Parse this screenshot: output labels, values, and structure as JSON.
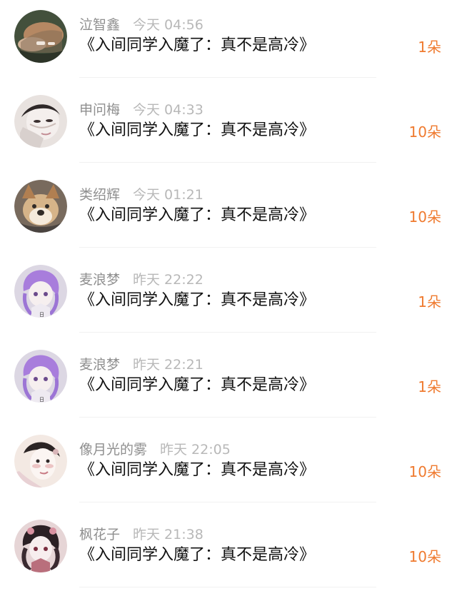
{
  "messages": [
    {
      "user": "泣智鑫",
      "time": "今天 04:56",
      "title": "《入间同学入魔了：真不是高冷》",
      "gift": "1朵",
      "avatar_icon": "avatar-photo-icon",
      "avatar_colors": [
        "#47503d",
        "#b78863",
        "#2c3527"
      ]
    },
    {
      "user": "申问梅",
      "time": "今天 04:33",
      "title": "《入间同学入魔了：真不是高冷》",
      "gift": "10朵",
      "avatar_icon": "avatar-photo-icon",
      "avatar_colors": [
        "#e7e1df",
        "#ddd3d0",
        "#312a2a"
      ]
    },
    {
      "user": "类绍辉",
      "time": "今天 01:21",
      "title": "《入间同学入魔了：真不是高冷》",
      "gift": "10朵",
      "avatar_icon": "avatar-dog-icon",
      "avatar_colors": [
        "#7d6c5c",
        "#d9b58c",
        "#37302c"
      ]
    },
    {
      "user": "麦浪梦",
      "time": "昨天 22:22",
      "title": "《入间同学入魔了：真不是高冷》",
      "gift": "1朵",
      "avatar_icon": "avatar-anime-icon",
      "avatar_colors": [
        "#d8d2e0",
        "#a57bd8",
        "#5d4a6d"
      ]
    },
    {
      "user": "麦浪梦",
      "time": "昨天 22:21",
      "title": "《入间同学入魔了：真不是高冷》",
      "gift": "1朵",
      "avatar_icon": "avatar-anime-icon",
      "avatar_colors": [
        "#d8d2e0",
        "#a57bd8",
        "#5d4a6d"
      ]
    },
    {
      "user": "像月光的雾",
      "time": "昨天 22:05",
      "title": "《入间同学入魔了：真不是高冷》",
      "gift": "10朵",
      "avatar_icon": "avatar-portrait-icon",
      "avatar_colors": [
        "#f2e7e1",
        "#e6b5b2",
        "#2c2525"
      ]
    },
    {
      "user": "枫花子",
      "time": "昨天 21:38",
      "title": "《入间同学入魔了：真不是高冷》",
      "gift": "10朵",
      "avatar_icon": "avatar-anime-girl-icon",
      "avatar_colors": [
        "#e3d1d2",
        "#b96f7c",
        "#2b2024"
      ]
    }
  ],
  "colors": {
    "name": "#8f8f8f",
    "time": "#b8b8b8",
    "title": "#111111",
    "gift": "#ef7a2f",
    "divider": "#f1f1f1"
  }
}
